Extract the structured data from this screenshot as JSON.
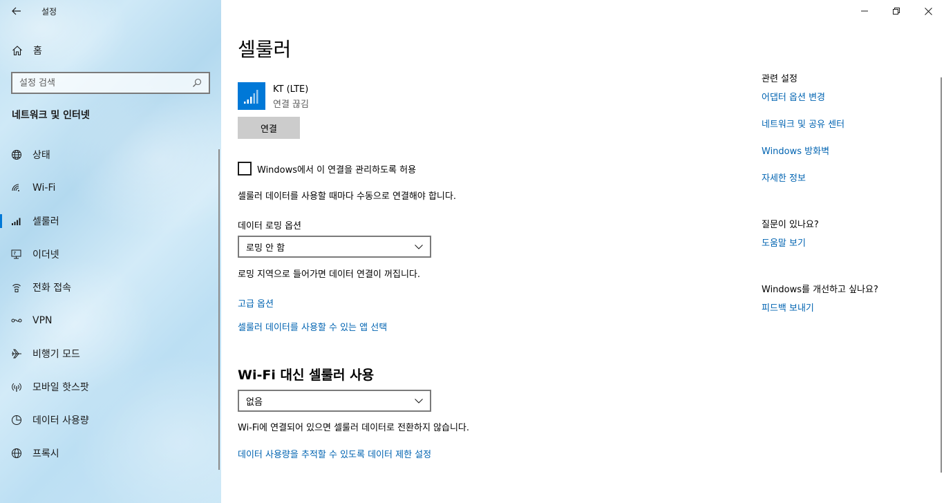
{
  "window": {
    "app_title": "설정",
    "controls": [
      "minimize",
      "restore",
      "close"
    ]
  },
  "sidebar": {
    "home_label": "홈",
    "search_placeholder": "설정 검색",
    "section_title": "네트워크 및 인터넷",
    "items": [
      {
        "label": "상태",
        "icon": "globe-status-icon",
        "selected": false
      },
      {
        "label": "Wi-Fi",
        "icon": "wifi-icon",
        "selected": false
      },
      {
        "label": "셀룰러",
        "icon": "cellular-icon",
        "selected": true
      },
      {
        "label": "이더넷",
        "icon": "ethernet-icon",
        "selected": false
      },
      {
        "label": "전화 접속",
        "icon": "dialup-icon",
        "selected": false
      },
      {
        "label": "VPN",
        "icon": "vpn-icon",
        "selected": false
      },
      {
        "label": "비행기 모드",
        "icon": "airplane-icon",
        "selected": false
      },
      {
        "label": "모바일 핫스팟",
        "icon": "hotspot-icon",
        "selected": false
      },
      {
        "label": "데이터 사용량",
        "icon": "data-usage-icon",
        "selected": false
      },
      {
        "label": "프록시",
        "icon": "proxy-globe-icon",
        "selected": false
      }
    ]
  },
  "main": {
    "title": "셀룰러",
    "network": {
      "name": "KT (LTE)",
      "status": "연결 끊김"
    },
    "connect_label": "연결",
    "manage_checkbox": {
      "label": "Windows에서 이 연결을 관리하도록 허용",
      "checked": false
    },
    "manual_note": "셀룰러 데이터를 사용할 때마다 수동으로 연결해야 합니다.",
    "roaming": {
      "label": "데이터 로밍 옵션",
      "value": "로밍 안 함",
      "note": "로밍 지역으로 들어가면 데이터 연결이 꺼집니다."
    },
    "advanced_link": "고급 옵션",
    "apps_link": "셀룰러 데이터를 사용할 수 있는 앱 선택",
    "wifi_section": {
      "heading": "Wi-Fi 대신 셀룰러 사용",
      "value": "없음",
      "note": "Wi-Fi에 연결되어 있으면 셀룰러 데이터로 전환하지 않습니다."
    },
    "data_limit_link": "데이터 사용량을 추적할 수 있도록 데이터 제한 설정"
  },
  "related": {
    "heading": "관련 설정",
    "links": [
      "어댑터 옵션 변경",
      "네트워크 및 공유 센터",
      "Windows 방화벽",
      "자세한 정보"
    ],
    "question_heading": "질문이 있나요?",
    "help_link": "도움말 보기",
    "improve_heading": "Windows를 개선하고 싶나요?",
    "feedback_link": "피드백 보내기"
  },
  "colors": {
    "accent": "#0078d7",
    "link": "#0063b1",
    "button_bg": "#cccccc"
  }
}
